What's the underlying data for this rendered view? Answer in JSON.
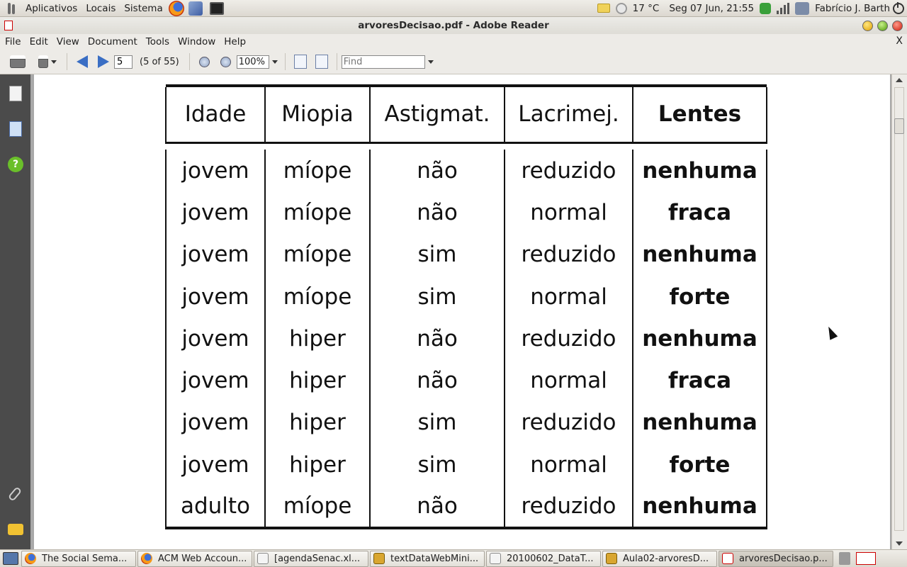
{
  "top_panel": {
    "menus": [
      "Aplicativos",
      "Locais",
      "Sistema"
    ],
    "temperature": "17 °C",
    "clock": "Seg 07 Jun, 21:55",
    "user": "Fabrício J. Barth"
  },
  "window": {
    "title": "arvoresDecisao.pdf - Adobe Reader"
  },
  "menu_bar": {
    "items": [
      "File",
      "Edit",
      "View",
      "Document",
      "Tools",
      "Window",
      "Help"
    ],
    "close_label": "X"
  },
  "toolbar": {
    "page_value": "5",
    "page_count": "(5 of 55)",
    "zoom_value": "100%",
    "find_placeholder": "Find"
  },
  "document": {
    "headers": [
      "Idade",
      "Miopia",
      "Astigmat.",
      "Lacrimej.",
      "Lentes"
    ],
    "rows": [
      [
        "jovem",
        "míope",
        "não",
        "reduzido",
        "nenhuma"
      ],
      [
        "jovem",
        "míope",
        "não",
        "normal",
        "fraca"
      ],
      [
        "jovem",
        "míope",
        "sim",
        "reduzido",
        "nenhuma"
      ],
      [
        "jovem",
        "míope",
        "sim",
        "normal",
        "forte"
      ],
      [
        "jovem",
        "hiper",
        "não",
        "reduzido",
        "nenhuma"
      ],
      [
        "jovem",
        "hiper",
        "não",
        "normal",
        "fraca"
      ],
      [
        "jovem",
        "hiper",
        "sim",
        "reduzido",
        "nenhuma"
      ],
      [
        "jovem",
        "hiper",
        "sim",
        "normal",
        "forte"
      ],
      [
        "adulto",
        "míope",
        "não",
        "reduzido",
        "nenhuma"
      ]
    ]
  },
  "taskbar": {
    "items": [
      {
        "label": "The Social Sema...",
        "icon": "firefox-icon"
      },
      {
        "label": "ACM Web Accoun...",
        "icon": "firefox-icon"
      },
      {
        "label": "[agendaSenac.xl...",
        "icon": "document-icon"
      },
      {
        "label": "textDataWebMini...",
        "icon": "spreadsheet-icon"
      },
      {
        "label": "20100602_DataT...",
        "icon": "document-icon"
      },
      {
        "label": "Aula02-arvoresD...",
        "icon": "spreadsheet-icon"
      },
      {
        "label": "arvoresDecisao.p...",
        "icon": "pdf-icon"
      }
    ]
  }
}
